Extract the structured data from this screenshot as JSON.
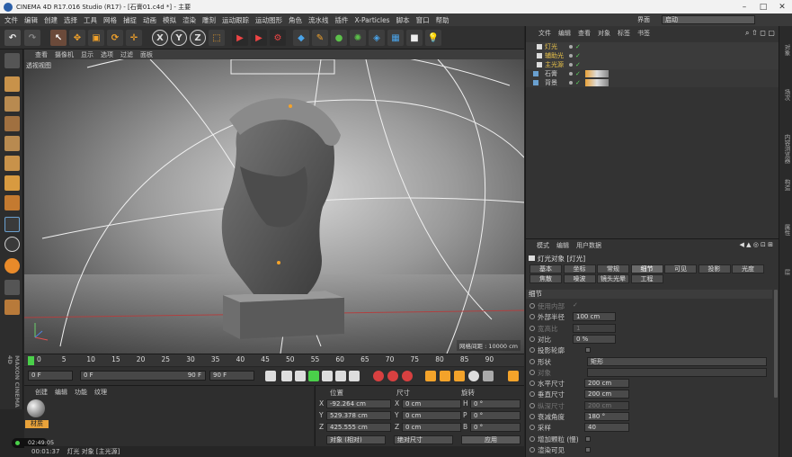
{
  "window": {
    "title": "CINEMA 4D R17.016 Studio (R17) - [石膏01.c4d *] - 主要"
  },
  "menu": [
    "文件",
    "编辑",
    "创建",
    "选择",
    "工具",
    "网格",
    "捕捉",
    "动画",
    "模拟",
    "渲染",
    "雕刻",
    "运动跟踪",
    "运动图形",
    "角色",
    "流水线",
    "插件",
    "X-Particles",
    "脚本",
    "窗口",
    "帮助"
  ],
  "layout": {
    "label": "界面",
    "value": "启动"
  },
  "viewport": {
    "menu": [
      "查看",
      "摄像机",
      "显示",
      "选项",
      "过滤",
      "面板"
    ],
    "label": "透视视图",
    "grid_info": "网格间距 : 10000 cm"
  },
  "timeline": {
    "ticks": [
      "0",
      "5",
      "10",
      "15",
      "20",
      "25",
      "30",
      "35",
      "40",
      "45",
      "50",
      "55",
      "60",
      "65",
      "70",
      "75",
      "80",
      "85",
      "90"
    ],
    "frame_label": "0 F"
  },
  "playback": {
    "start": "0 F",
    "current": "0 F",
    "end": "90 F",
    "max": "90 F"
  },
  "material_manager": {
    "menu": [
      "创建",
      "编辑",
      "功能",
      "纹理"
    ],
    "material_name": "材质"
  },
  "coordinates": {
    "headers": [
      "位置",
      "尺寸",
      "旋转"
    ],
    "rows": [
      {
        "axis": "X",
        "pos": "-92.264 cm",
        "size_axis": "X",
        "size": "0 cm",
        "rot_axis": "H",
        "rot": "0 °"
      },
      {
        "axis": "Y",
        "pos": "529.378 cm",
        "size_axis": "Y",
        "size": "0 cm",
        "rot_axis": "P",
        "rot": "0 °"
      },
      {
        "axis": "Z",
        "pos": "425.555 cm",
        "size_axis": "Z",
        "size": "0 cm",
        "rot_axis": "B",
        "rot": "0 °"
      }
    ],
    "mode": "对象 (相对)",
    "size_mode": "绝对尺寸",
    "apply": "应用"
  },
  "status": {
    "time": "00:01:37",
    "message": "灯光 对象 [主光源]",
    "record_time": "02:49:05"
  },
  "object_manager": {
    "menu": [
      "文件",
      "编辑",
      "查看",
      "对象",
      "标签",
      "书签"
    ],
    "objects": [
      {
        "name": "灯光",
        "color": "#e8c24a"
      },
      {
        "name": "辅助光",
        "color": "#e8c24a"
      },
      {
        "name": "主光源",
        "color": "#e8c24a"
      },
      {
        "name": "石膏",
        "color": "#cfcfcf"
      },
      {
        "name": "背景",
        "color": "#cfcfcf"
      }
    ]
  },
  "attributes": {
    "menu": [
      "模式",
      "编辑",
      "用户数据"
    ],
    "object_title": "灯光对象 [灯光]",
    "tabs_row1": [
      "基本",
      "坐标",
      "常规",
      "细节",
      "可见",
      "投影",
      "光度"
    ],
    "tabs_row2": [
      "焦散",
      "噪波",
      "镜头光晕",
      "工程"
    ],
    "active_tab": "细节",
    "section": "细节",
    "rows": [
      {
        "label": "使用内部",
        "value": "✓",
        "dim": true
      },
      {
        "label": "外部半径",
        "value": "100 cm",
        "dim": false
      },
      {
        "label": "宽高比",
        "value": "1",
        "dim": true
      },
      {
        "label": "对比",
        "value": "0 %",
        "dim": false
      },
      {
        "label": "投影轮廓",
        "value": "",
        "dim": false
      },
      {
        "label": "形状",
        "value": "矩形",
        "dim": false
      },
      {
        "label": "对象",
        "value": "",
        "dim": true
      },
      {
        "label": "水平尺寸",
        "value": "200 cm",
        "dim": false
      },
      {
        "label": "垂直尺寸",
        "value": "200 cm",
        "dim": false
      },
      {
        "label": "纵深尺寸",
        "value": "200 cm",
        "dim": true
      },
      {
        "label": "衰减角度",
        "value": "180 °",
        "dim": false
      },
      {
        "label": "采样",
        "value": "40",
        "dim": false
      },
      {
        "label": "增加颗粒 (慢)",
        "value": "",
        "dim": false
      },
      {
        "label": "渲染可见",
        "value": "",
        "dim": false
      }
    ]
  },
  "side_strip": {
    "left_brand": "MAXON CINEMA 4D",
    "right_tabs": [
      "对象",
      "场次",
      "内容浏览器",
      "构造",
      "属性",
      "层"
    ]
  }
}
